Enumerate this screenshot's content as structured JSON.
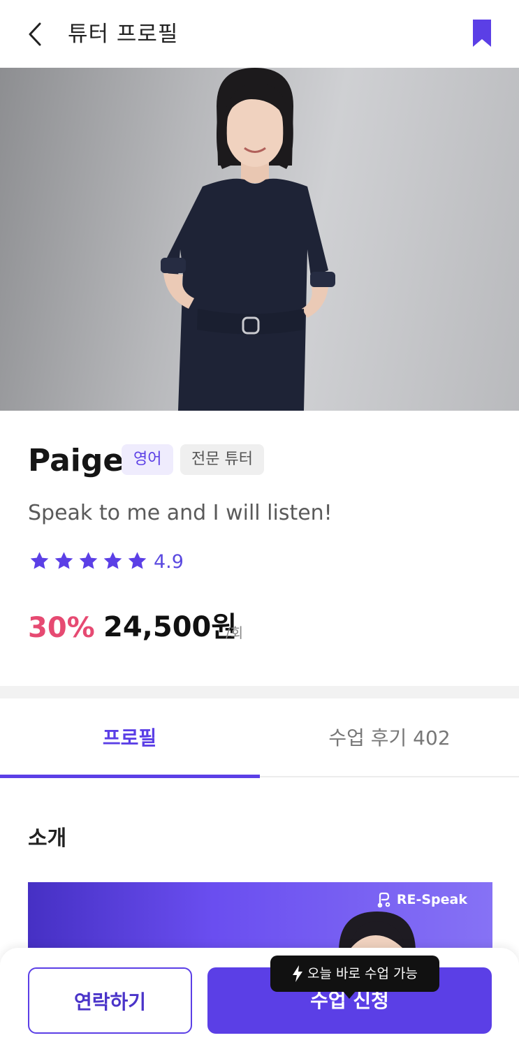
{
  "header": {
    "title": "튜터 프로필",
    "back_icon": "chevron-left-icon",
    "bookmark_icon": "bookmark-icon"
  },
  "tutor": {
    "name": "Paige",
    "tags": [
      "영어",
      "전문 튜터"
    ],
    "tagline": "Speak to me and I will listen!",
    "rating": "4.9",
    "stars": 5,
    "discount": "30%",
    "price": "24,500원",
    "price_unit": "/회"
  },
  "tabs": [
    {
      "label": "프로필",
      "active": true
    },
    {
      "label": "수업 후기 402",
      "active": false
    }
  ],
  "section": {
    "intro_title": "소개"
  },
  "intro_banner": {
    "brand": "RE-Speak"
  },
  "bottom_bar": {
    "contact_label": "연락하기",
    "apply_label": "수업 신청",
    "tooltip": "오늘 바로 수업 가능"
  },
  "colors": {
    "accent": "#5b3fe6",
    "discount": "#e64a72",
    "star": "#5b3fe6"
  }
}
